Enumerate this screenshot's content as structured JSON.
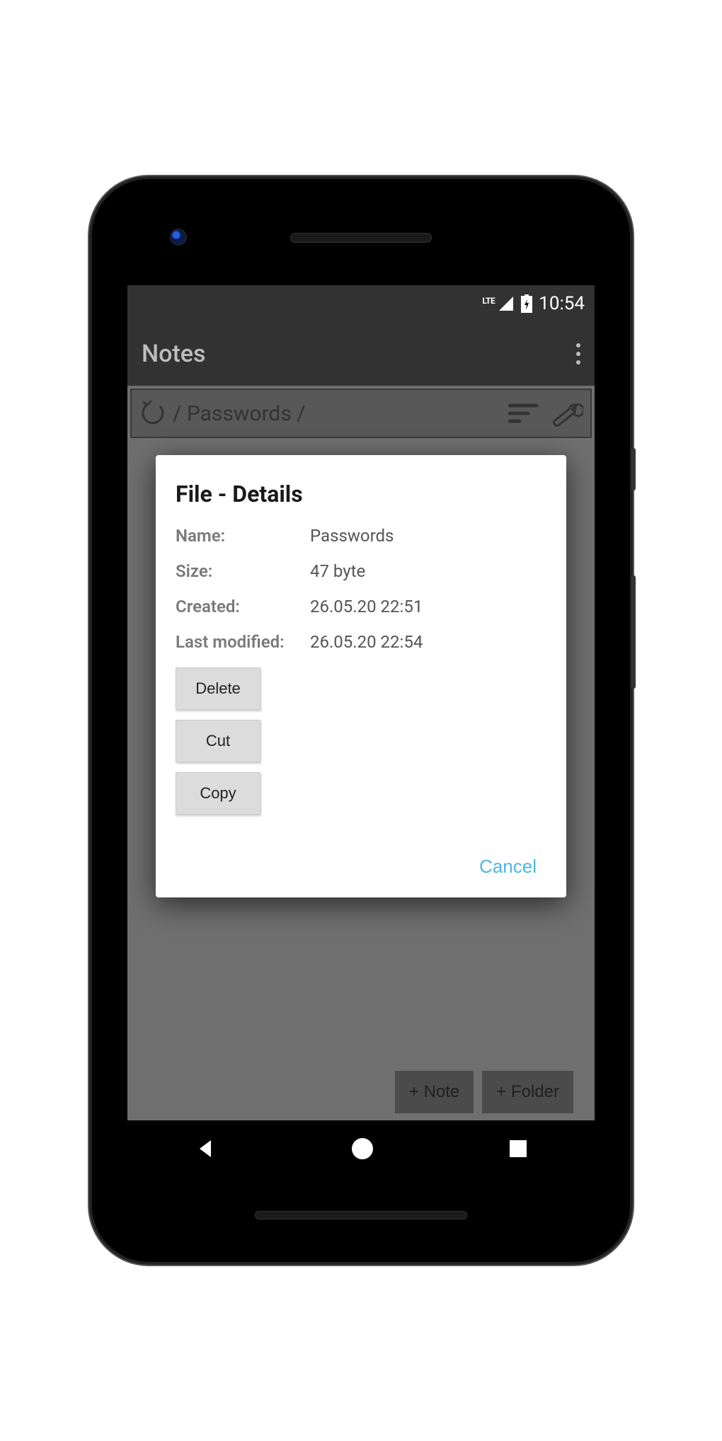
{
  "status": {
    "time": "10:54",
    "network": "LTE"
  },
  "appbar": {
    "title": "Notes"
  },
  "breadcrumb": {
    "path": "/ Passwords /"
  },
  "fabs": {
    "note": "+ Note",
    "folder": "+ Folder"
  },
  "dialog": {
    "title": "File - Details",
    "labels": {
      "name": "Name:",
      "size": "Size:",
      "created": "Created:",
      "modified": "Last modified:"
    },
    "values": {
      "name": "Passwords",
      "size": "47 byte",
      "created": "26.05.20 22:51",
      "modified": "26.05.20 22:54"
    },
    "actions": {
      "delete": "Delete",
      "cut": "Cut",
      "copy": "Copy",
      "cancel": "Cancel"
    }
  }
}
